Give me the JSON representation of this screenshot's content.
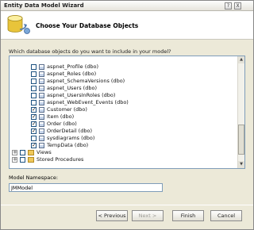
{
  "window": {
    "title": "Entity Data Model Wizard",
    "help_btn": "?",
    "close_btn": "X"
  },
  "header": {
    "heading": "Choose Your Database Objects"
  },
  "prompt": "Which database objects do you want to include in your model?",
  "tree": {
    "tables": [
      {
        "label": "aspnet_Profile (dbo)",
        "checked": false
      },
      {
        "label": "aspnet_Roles (dbo)",
        "checked": false
      },
      {
        "label": "aspnet_SchemaVersions (dbo)",
        "checked": false
      },
      {
        "label": "aspnet_Users (dbo)",
        "checked": false
      },
      {
        "label": "aspnet_UsersInRoles (dbo)",
        "checked": false
      },
      {
        "label": "aspnet_WebEvent_Events (dbo)",
        "checked": false
      },
      {
        "label": "Customer (dbo)",
        "checked": true
      },
      {
        "label": "Item (dbo)",
        "checked": true
      },
      {
        "label": "Order (dbo)",
        "checked": true
      },
      {
        "label": "OrderDetail (dbo)",
        "checked": true
      },
      {
        "label": "sysdiagrams (dbo)",
        "checked": false
      },
      {
        "label": "TempData (dbo)",
        "checked": true
      }
    ],
    "views_label": "Views",
    "procs_label": "Stored Procedures",
    "expand_glyph": "+"
  },
  "namespace": {
    "label": "Model Namespace:",
    "value": "JMModel"
  },
  "buttons": {
    "previous": "< Previous",
    "next": "Next >",
    "finish": "Finish",
    "cancel": "Cancel"
  }
}
